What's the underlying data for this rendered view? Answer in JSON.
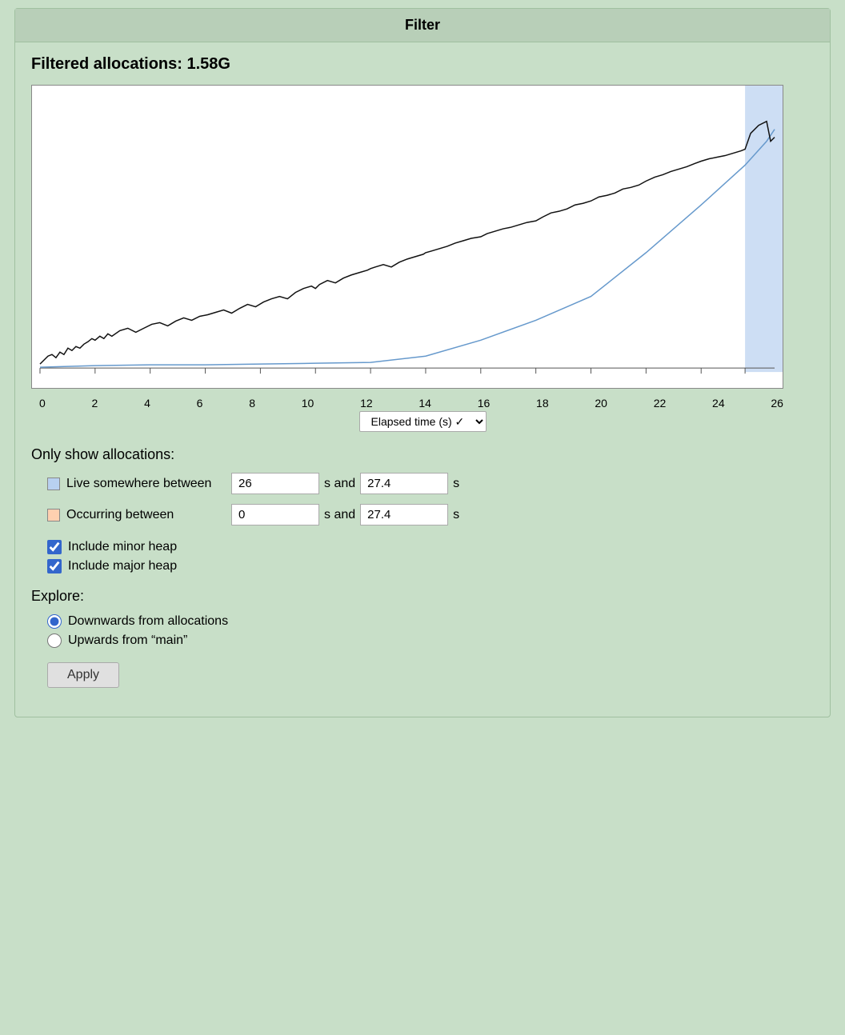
{
  "header": {
    "title": "Filter"
  },
  "filtered_allocations": {
    "label": "Filtered allocations: 1.58G"
  },
  "chart": {
    "x_labels": [
      "0",
      "2",
      "4",
      "6",
      "8",
      "10",
      "12",
      "14",
      "16",
      "18",
      "20",
      "22",
      "24",
      "26"
    ],
    "highlight_start": 26,
    "highlight_end": 27.4,
    "total_x": 27.4
  },
  "elapsed_dropdown": {
    "label": "Elapsed time (s) ✓",
    "options": [
      "Elapsed time (s)"
    ]
  },
  "only_show_label": "Only show allocations:",
  "live_between": {
    "label": "Live somewhere between",
    "color": "blue",
    "from_value": "26",
    "to_value": "27.4",
    "unit": "s"
  },
  "occurring_between": {
    "label": "Occurring between",
    "color": "orange",
    "from_value": "0",
    "to_value": "27.4",
    "unit": "s"
  },
  "checkboxes": {
    "minor_heap": {
      "label": "Include minor heap",
      "checked": true
    },
    "major_heap": {
      "label": "Include major heap",
      "checked": true
    }
  },
  "explore": {
    "label": "Explore:",
    "options": [
      {
        "label": "Downwards from allocations",
        "selected": true
      },
      {
        "label": "Upwards from “main”",
        "selected": false
      }
    ]
  },
  "apply_button": {
    "label": "Apply"
  }
}
